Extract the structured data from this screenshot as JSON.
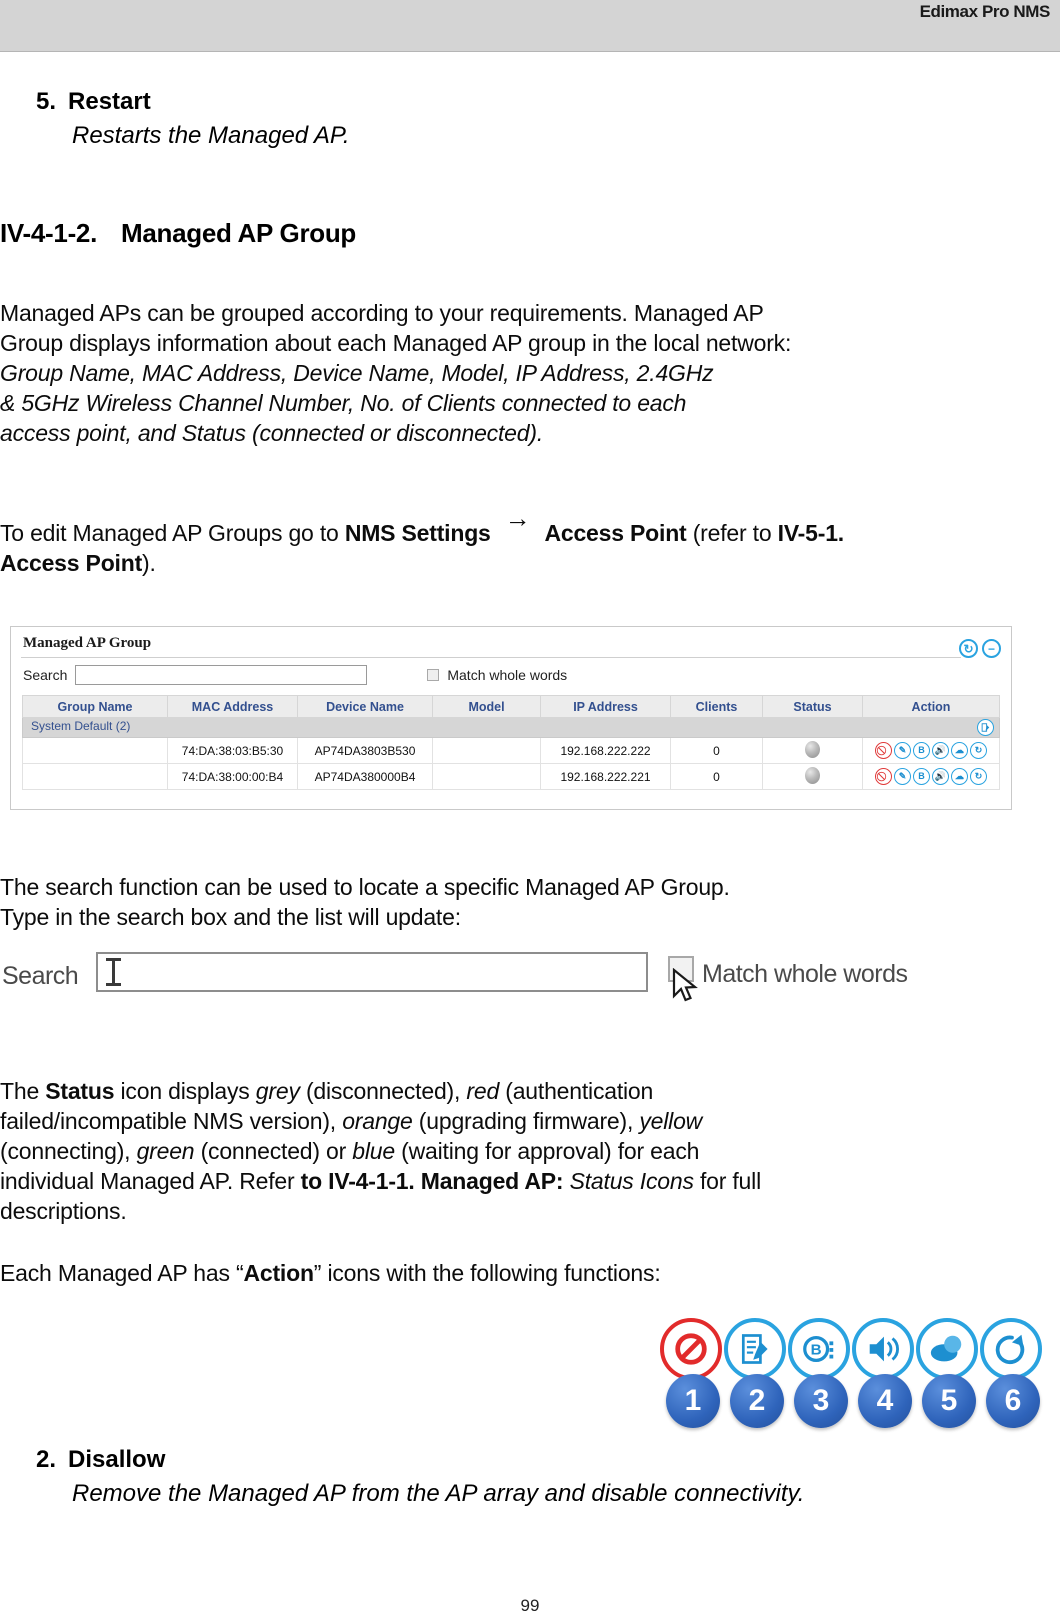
{
  "header": {
    "title": "Edimax Pro NMS"
  },
  "section_restart": {
    "number": "5.",
    "title": "Restart",
    "description": "Restarts the Managed AP."
  },
  "heading": {
    "section_number": "IV-4-1-2.",
    "title": "Managed AP Group"
  },
  "intro": {
    "line1": "Managed APs can be grouped according to your requirements. Managed AP",
    "line2": "Group displays information about each Managed AP group in the local network:",
    "line3_italic": "Group Name, MAC Address, Device Name, Model, IP Address, 2.4GHz",
    "line4_italic": "& 5GHz Wireless Channel Number, No. of Clients connected to each",
    "line5_italic": "access point, and Status (connected or disconnected)."
  },
  "edit_note": {
    "prefix": "To edit Managed AP Groups go to ",
    "bold1": "NMS Settings",
    "arrow": "→",
    "bold2": "Access Point",
    "mid": " (refer to ",
    "bold3": "IV-5-1.",
    "bold4": "Access Point",
    "suffix": ")."
  },
  "nms_panel": {
    "title": "Managed AP Group",
    "toolbar": [
      {
        "name": "refresh-icon",
        "glyph": "↻"
      },
      {
        "name": "collapse-icon",
        "glyph": "−"
      }
    ],
    "search": {
      "label": "Search",
      "value": "",
      "placeholder": "",
      "match_whole_words_label": "Match whole words",
      "match_whole_words_checked": false
    },
    "columns": [
      "Group Name",
      "MAC Address",
      "Device Name",
      "Model",
      "IP Address",
      "Clients",
      "Status",
      "Action"
    ],
    "group_row": {
      "label": "System Default (2)",
      "edit_icon": "group-edit-icon"
    },
    "rows": [
      {
        "group_name": "",
        "mac_address": "74:DA:38:03:B5:30",
        "device_name": "AP74DA3803B530",
        "model": "",
        "ip_address": "192.168.222.222",
        "clients": "0",
        "status": "grey",
        "actions": [
          "disallow-icon",
          "edit-icon",
          "blink-icon",
          "buzzer-icon",
          "network-icon",
          "restart-icon"
        ]
      },
      {
        "group_name": "",
        "mac_address": "74:DA:38:00:00:B4",
        "device_name": "AP74DA380000B4",
        "model": "",
        "ip_address": "192.168.222.221",
        "clients": "0",
        "status": "grey",
        "actions": [
          "disallow-icon",
          "edit-icon",
          "blink-icon",
          "buzzer-icon",
          "network-icon",
          "restart-icon"
        ]
      }
    ],
    "colors": {
      "accent": "#2aa3e0",
      "red": "#e22b2b",
      "header_bg": "#ececec",
      "group_bg": "#d6d6d6",
      "link": "#4b3fbd",
      "column_text": "#33508f"
    }
  },
  "search_para": {
    "line1": "The search function can be used to locate a specific Managed AP Group.",
    "line2": "Type in the search box and the list will update:"
  },
  "search_closeup": {
    "label": "Search",
    "value": "",
    "match_whole_words_label": "Match whole words",
    "checked": false
  },
  "status_para": {
    "p1": "The ",
    "bold_status": "Status",
    "p2": " icon displays ",
    "i_grey": "grey",
    "p3": " (disconnected), ",
    "i_red": "red",
    "p4": " (authentication",
    "p5": "failed/incompatible NMS version), ",
    "i_orange": "orange",
    "p6": " (upgrading firmware), ",
    "i_yellow": "yellow",
    "p7": "(connecting), ",
    "i_green": "green",
    "p8": " (connected) or ",
    "i_blue": "blue",
    "p9": " (waiting for approval) for each",
    "p10": "individual Managed AP. Refer ",
    "bold_ref": "to IV-4-1-1. Managed AP:",
    "i_ref": " Status Icons",
    "p11": " for full",
    "p12": "descriptions."
  },
  "action_para": {
    "prefix": "Each Managed AP has “",
    "bold": "Action",
    "suffix": "” icons with the following functions:"
  },
  "action_icons": [
    {
      "number": "1",
      "name": "disallow-icon",
      "color": "#e22b2b"
    },
    {
      "number": "2",
      "name": "edit-icon",
      "color": "#2aa3e0"
    },
    {
      "number": "3",
      "name": "blink-led-icon",
      "color": "#2aa3e0"
    },
    {
      "number": "4",
      "name": "buzzer-icon",
      "color": "#2aa3e0"
    },
    {
      "number": "5",
      "name": "network-icon",
      "color": "#2aa3e0"
    },
    {
      "number": "6",
      "name": "restart-icon",
      "color": "#2aa3e0"
    }
  ],
  "section_disallow": {
    "number": "2.",
    "title": "Disallow",
    "description": "Remove the Managed AP from the AP array and disable connectivity."
  },
  "page_number": "99"
}
